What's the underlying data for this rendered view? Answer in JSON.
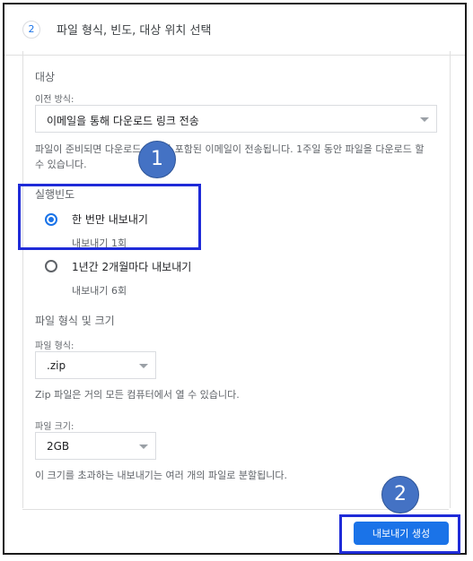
{
  "header": {
    "step_number": "2",
    "title": "파일 형식, 빈도, 대상 위치 선택"
  },
  "destination": {
    "section_title": "대상",
    "method_label": "이전 방식:",
    "method_value": "이메일을 통해 다운로드 링크 전송",
    "description": "파일이 준비되면 다운로드 링크가 포함된 이메일이 전송됩니다. 1주일 동안 파일을 다운로드 할 수 있습니다."
  },
  "frequency": {
    "section_title": "실행빈도",
    "options": [
      {
        "label": "한 번만 내보내기",
        "sub": "내보내기 1회",
        "checked": true
      },
      {
        "label": "1년간 2개월마다 내보내기",
        "sub": "내보내기 6회",
        "checked": false
      }
    ]
  },
  "file": {
    "section_title": "파일 형식 및 크기",
    "type_label": "파일 형식:",
    "type_value": ".zip",
    "type_desc": "Zip 파일은 거의 모든 컴퓨터에서 열 수 있습니다.",
    "size_label": "파일 크기:",
    "size_value": "2GB",
    "size_desc": "이 크기를 초과하는 내보내기는 여러 개의 파일로 분할됩니다."
  },
  "footer": {
    "create_label": "내보내기 생성"
  },
  "annotations": {
    "badge1": "1",
    "badge2": "2",
    "highlight_color": "#1f2bd8",
    "badge_color": "#4472c4"
  },
  "colors": {
    "accent": "#1a73e8"
  }
}
